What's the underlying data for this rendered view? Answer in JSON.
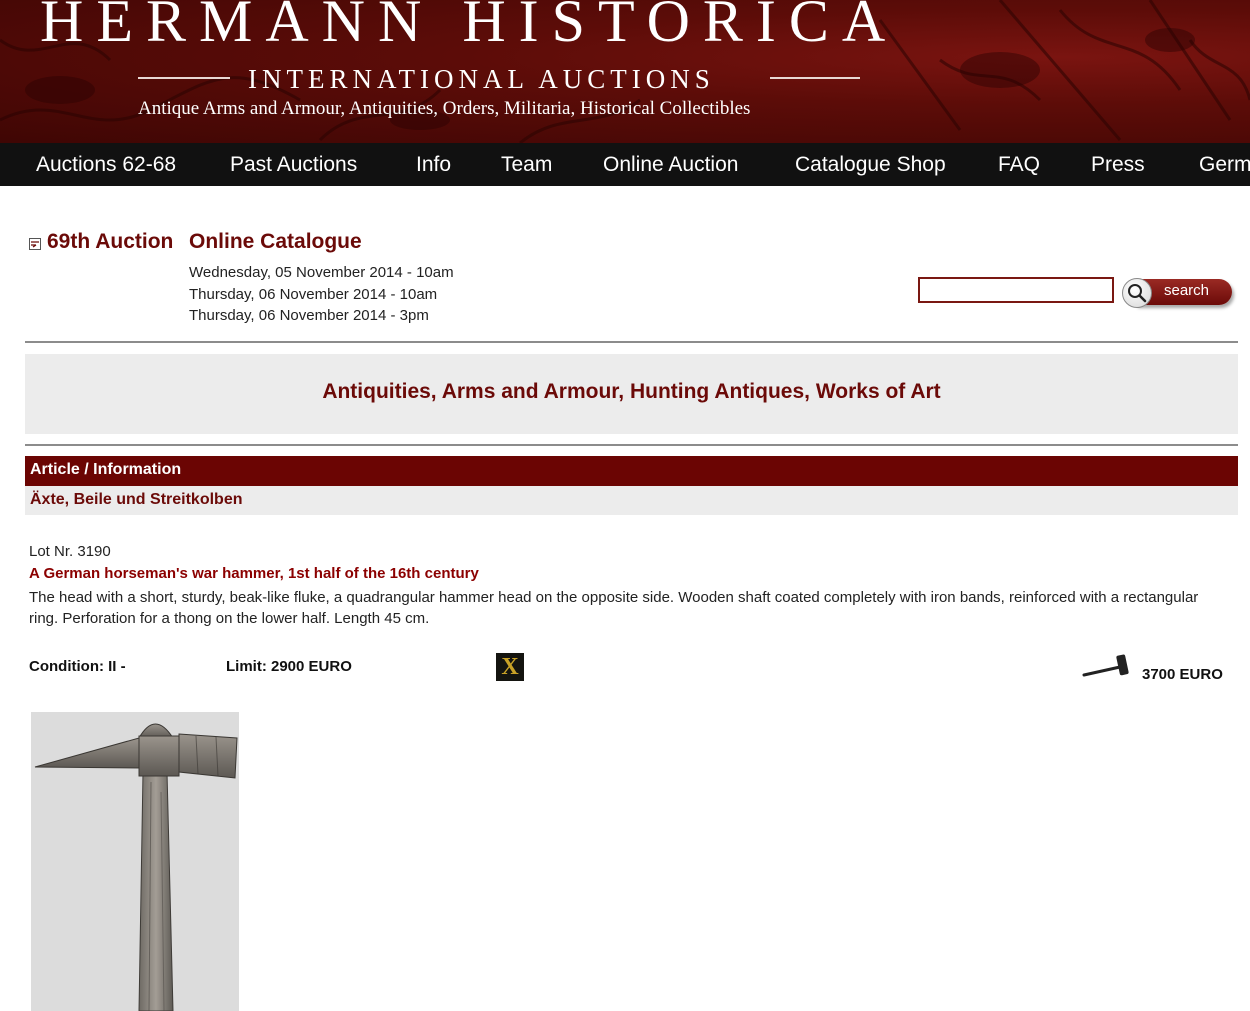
{
  "header": {
    "brand": "HERMANN HISTORICA",
    "subtitle": "INTERNATIONAL AUCTIONS",
    "tagline": "Antique Arms and Armour, Antiquities, Orders, Militaria, Historical Collectibles"
  },
  "nav": {
    "items": [
      {
        "label": "Auctions 62-68"
      },
      {
        "label": "Past Auctions"
      },
      {
        "label": "Info"
      },
      {
        "label": "Team"
      },
      {
        "label": "Online Auction"
      },
      {
        "label": "Catalogue Shop"
      },
      {
        "label": "FAQ"
      },
      {
        "label": "Press"
      },
      {
        "label": "Germ"
      }
    ]
  },
  "auction": {
    "number": "69th Auction",
    "catalogue_link": "Online Catalogue",
    "dates": [
      "Wednesday, 05 November 2014 - 10am",
      "Thursday, 06 November 2014 - 10am",
      "Thursday, 06 November 2014 - 3pm"
    ]
  },
  "search": {
    "value": "",
    "button_label": "search"
  },
  "category": {
    "title": "Antiquities, Arms and Armour, Hunting Antiques, Works of Art"
  },
  "article": {
    "bar_label": "Article / Information",
    "subcategory": "Äxte, Beile und Streitkolben"
  },
  "lot": {
    "number_text": "Lot Nr. 3190",
    "title": "A German horseman's war hammer, 1st half of the 16th century",
    "description": "The head with a short, sturdy, beak-like fluke, a quadrangular hammer head on the opposite side. Wooden shaft coated completely with iron bands, reinforced with a rectangular ring. Perforation for a thong on the lower half. Length 45 cm.",
    "condition": "Condition: II -",
    "limit": "Limit: 2900 EURO",
    "badge": "X",
    "hammer_price": "3700 EURO"
  },
  "colors": {
    "brand_red": "#6b0503",
    "nav_bg": "#111111",
    "band_gray": "#ececec"
  }
}
